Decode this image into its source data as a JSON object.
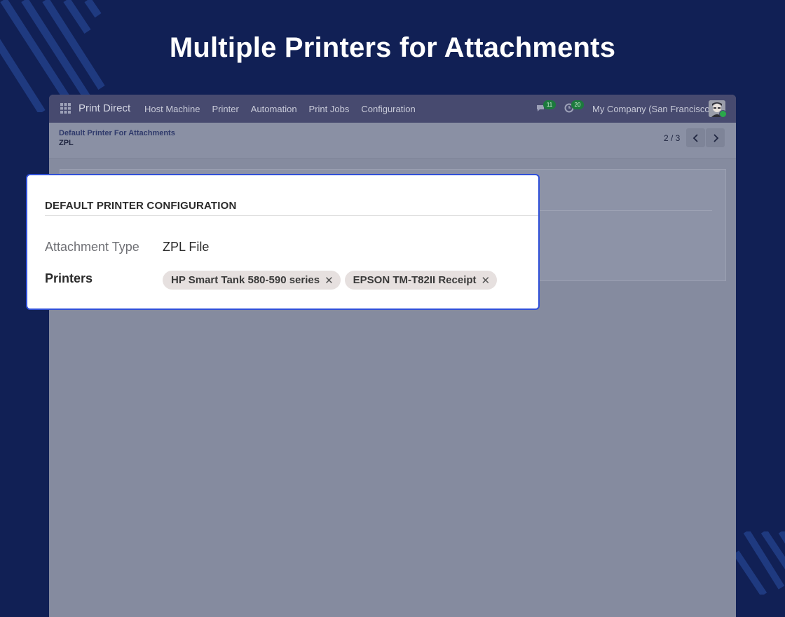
{
  "headline": "Multiple Printers for Attachments",
  "navbar": {
    "app_name": "Print Direct",
    "menu": [
      "Host Machine",
      "Printer",
      "Automation",
      "Print Jobs",
      "Configuration"
    ],
    "messages_count": "11",
    "activities_count": "20",
    "company": "My Company (San Francisco)"
  },
  "control": {
    "breadcrumb_parent": "Default Printer For Attachments",
    "breadcrumb_current": "ZPL",
    "pager": "2 / 3"
  },
  "form": {
    "section_title": "DEFAULT PRINTER CONFIGURATION",
    "attachment_type_label": "Attachment Type",
    "attachment_type_value": "ZPL File",
    "printers_label": "Printers",
    "printers": [
      "HP Smart Tank 580-590 series",
      "EPSON TM-T82II Receipt"
    ]
  },
  "icons": {
    "apps": "apps-grid-icon",
    "messages": "chat-icon",
    "activities": "clock-icon",
    "prev": "chevron-left-icon",
    "next": "chevron-right-icon",
    "remove": "close-icon"
  },
  "colors": {
    "background": "#112055",
    "navbar": "#474a6f",
    "highlight_border": "#2f4fd8",
    "badge": "#1c7a3d",
    "tag": "#e6e0df"
  }
}
